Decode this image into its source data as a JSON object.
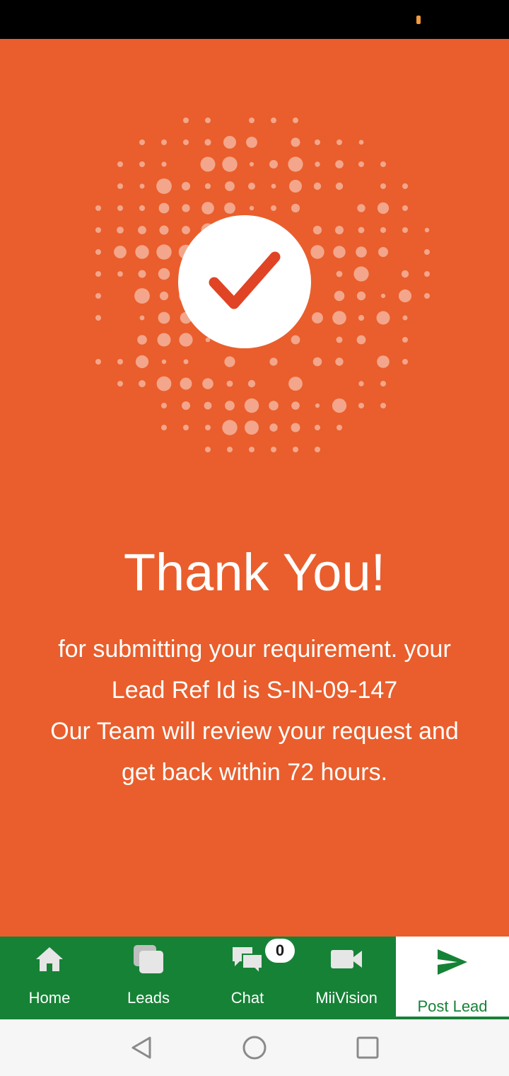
{
  "colors": {
    "background": "#e95e2c",
    "nav_green": "#168236",
    "check_red": "#e04424",
    "status_indicator": "#f29a3c"
  },
  "success": {
    "icon": "checkmark-icon",
    "title": "Thank You!",
    "message_line1": "for submitting your requirement. your",
    "message_line2": "Lead Ref Id is S-IN-09-147",
    "message_line3": "Our Team will review your request and",
    "message_line4": "get back within 72 hours."
  },
  "bottom_nav": {
    "items": [
      {
        "label": "Home",
        "icon": "home-icon"
      },
      {
        "label": "Leads",
        "icon": "leads-stack-icon"
      },
      {
        "label": "Chat",
        "icon": "chat-icon",
        "badge": "0"
      },
      {
        "label": "MiiVision",
        "icon": "video-camera-icon"
      },
      {
        "label": "Post Lead",
        "icon": "send-icon",
        "active": true
      }
    ]
  },
  "system_nav": {
    "back": "back-icon",
    "home": "home-circle-icon",
    "recents": "recents-icon"
  }
}
